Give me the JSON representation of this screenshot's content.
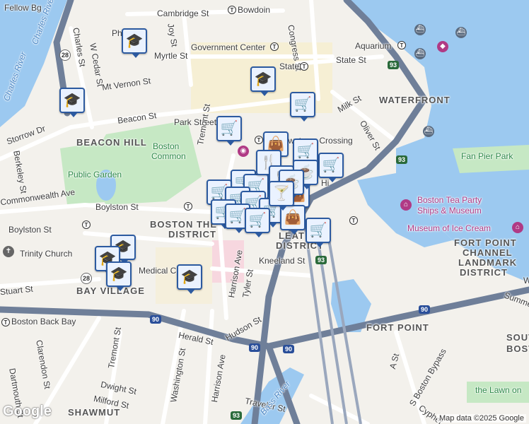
{
  "map": {
    "colors": {
      "water": "#9cc9f0",
      "land": "#f3f1ec",
      "park": "#c6e8c4",
      "highway": "#6f7f99",
      "road": "#ffffff",
      "marker_border": "#2c5aa0",
      "marker_fill": "#eaf2ff"
    },
    "streets": [
      {
        "name": "Fellow Bg"
      },
      {
        "name": "Cambridge St"
      },
      {
        "name": "Bowdoin"
      },
      {
        "name": "Congress St"
      },
      {
        "name": "Joy St"
      },
      {
        "name": "Charles St"
      },
      {
        "name": "W Cedar St"
      },
      {
        "name": "Myrtle St"
      },
      {
        "name": "Government Center"
      },
      {
        "name": "State St"
      },
      {
        "name": "State"
      },
      {
        "name": "Aquarium"
      },
      {
        "name": "Mt Vernon St"
      },
      {
        "name": "Milk St"
      },
      {
        "name": "Beacon St"
      },
      {
        "name": "Park Street"
      },
      {
        "name": "Storrow Dr"
      },
      {
        "name": "Downtown Crossing"
      },
      {
        "name": "Oliver St"
      },
      {
        "name": "Berkeley St"
      },
      {
        "name": "Tremont St"
      },
      {
        "name": "Commonwealth Ave"
      },
      {
        "name": "Boylston St"
      },
      {
        "name": "Harrison Ave"
      },
      {
        "name": "Tyler St"
      },
      {
        "name": "Kneeland St"
      },
      {
        "name": "Stuart St"
      },
      {
        "name": "Hudson St"
      },
      {
        "name": "Herald St"
      },
      {
        "name": "Washington St"
      },
      {
        "name": "Clarendon St"
      },
      {
        "name": "Dartmouth St"
      },
      {
        "name": "Dwight St"
      },
      {
        "name": "Milford St"
      },
      {
        "name": "Traveler St"
      },
      {
        "name": "A St"
      },
      {
        "name": "S Boston Bypass"
      },
      {
        "name": "Cypher"
      },
      {
        "name": "Summer"
      },
      {
        "name": "Medical Center"
      },
      {
        "name": "Hi"
      },
      {
        "name": "Wa"
      },
      {
        "name": "Ph"
      },
      {
        "name": "Fan Pier Park"
      },
      {
        "name": "the Lawn on"
      }
    ],
    "districts": [
      {
        "name": "BEACON HILL"
      },
      {
        "name": "WATERFRONT"
      },
      {
        "name": "BOSTON THEATER DISTRICT",
        "line1": "BOSTON THE",
        "line2": "DISTRICT"
      },
      {
        "name": "LEATHER DISTRICT",
        "line1": "LEATH",
        "line2": "DISTRICT"
      },
      {
        "name": "FORT POINT CHANNEL LANDMARK DISTRICT",
        "line1": "FORT POINT",
        "line2": "CHANNEL",
        "line3": "LANDMARK",
        "line4": "DISTRICT"
      },
      {
        "name": "BAY VILLAGE"
      },
      {
        "name": "FORT POINT"
      },
      {
        "name": "SHAWMUT"
      },
      {
        "name": "SOUTH",
        "line1": "SOUT"
      },
      {
        "name": "BOSTON",
        "line1": "BOST"
      }
    ],
    "water_labels": [
      {
        "name": "Charles River"
      },
      {
        "name": "Charles River"
      },
      {
        "name": "Bass River"
      }
    ],
    "parks": [
      {
        "name": "Boston Common",
        "line1": "Boston",
        "line2": "Common"
      },
      {
        "name": "Public Garden"
      }
    ],
    "pois": [
      {
        "name": "Boston Tea Party Ships & Museum",
        "line1": "Boston Tea Party",
        "line2": "Ships & Museum"
      },
      {
        "name": "Museum of Ice Cream"
      },
      {
        "name": "Trinity Church"
      },
      {
        "name": "Boston Back Bay"
      }
    ],
    "highway_shields": [
      {
        "route": "93"
      },
      {
        "route": "93"
      },
      {
        "route": "93"
      },
      {
        "route": "93"
      },
      {
        "route": "90"
      },
      {
        "route": "90"
      },
      {
        "route": "90"
      },
      {
        "route": "90"
      },
      {
        "route": "28"
      },
      {
        "route": "28"
      }
    ],
    "markers": [
      {
        "type": "school",
        "icon": "graduation-cap-icon"
      },
      {
        "type": "school",
        "icon": "graduation-cap-icon"
      },
      {
        "type": "school",
        "icon": "graduation-cap-icon"
      },
      {
        "type": "school",
        "icon": "graduation-cap-icon"
      },
      {
        "type": "school",
        "icon": "graduation-cap-icon"
      },
      {
        "type": "school",
        "icon": "graduation-cap-icon"
      },
      {
        "type": "school",
        "icon": "graduation-cap-icon"
      },
      {
        "type": "grocery",
        "icon": "shopping-cart-icon"
      },
      {
        "type": "grocery",
        "icon": "shopping-cart-icon"
      },
      {
        "type": "grocery",
        "icon": "shopping-cart-icon"
      },
      {
        "type": "grocery",
        "icon": "shopping-cart-icon"
      },
      {
        "type": "grocery",
        "icon": "shopping-cart-icon"
      },
      {
        "type": "grocery",
        "icon": "shopping-cart-icon"
      },
      {
        "type": "grocery",
        "icon": "shopping-cart-icon"
      },
      {
        "type": "grocery",
        "icon": "shopping-cart-icon"
      },
      {
        "type": "grocery",
        "icon": "shopping-cart-icon"
      },
      {
        "type": "grocery",
        "icon": "shopping-cart-icon"
      },
      {
        "type": "grocery",
        "icon": "shopping-cart-icon"
      },
      {
        "type": "grocery",
        "icon": "shopping-cart-icon"
      },
      {
        "type": "grocery",
        "icon": "shopping-cart-icon"
      },
      {
        "type": "grocery",
        "icon": "shopping-cart-icon"
      },
      {
        "type": "shopping",
        "icon": "shopping-bag-icon"
      },
      {
        "type": "shopping",
        "icon": "shopping-bag-icon"
      },
      {
        "type": "shopping",
        "icon": "shopping-bag-icon"
      },
      {
        "type": "restaurant",
        "icon": "fork-knife-icon"
      },
      {
        "type": "restaurant",
        "icon": "fork-knife-icon"
      },
      {
        "type": "cafe",
        "icon": "coffee-cup-icon"
      },
      {
        "type": "cafe",
        "icon": "coffee-cup-icon"
      },
      {
        "type": "bar",
        "icon": "cocktail-glass-icon"
      }
    ],
    "logo": "Google",
    "attribution": "Map data ©2025 Google"
  }
}
